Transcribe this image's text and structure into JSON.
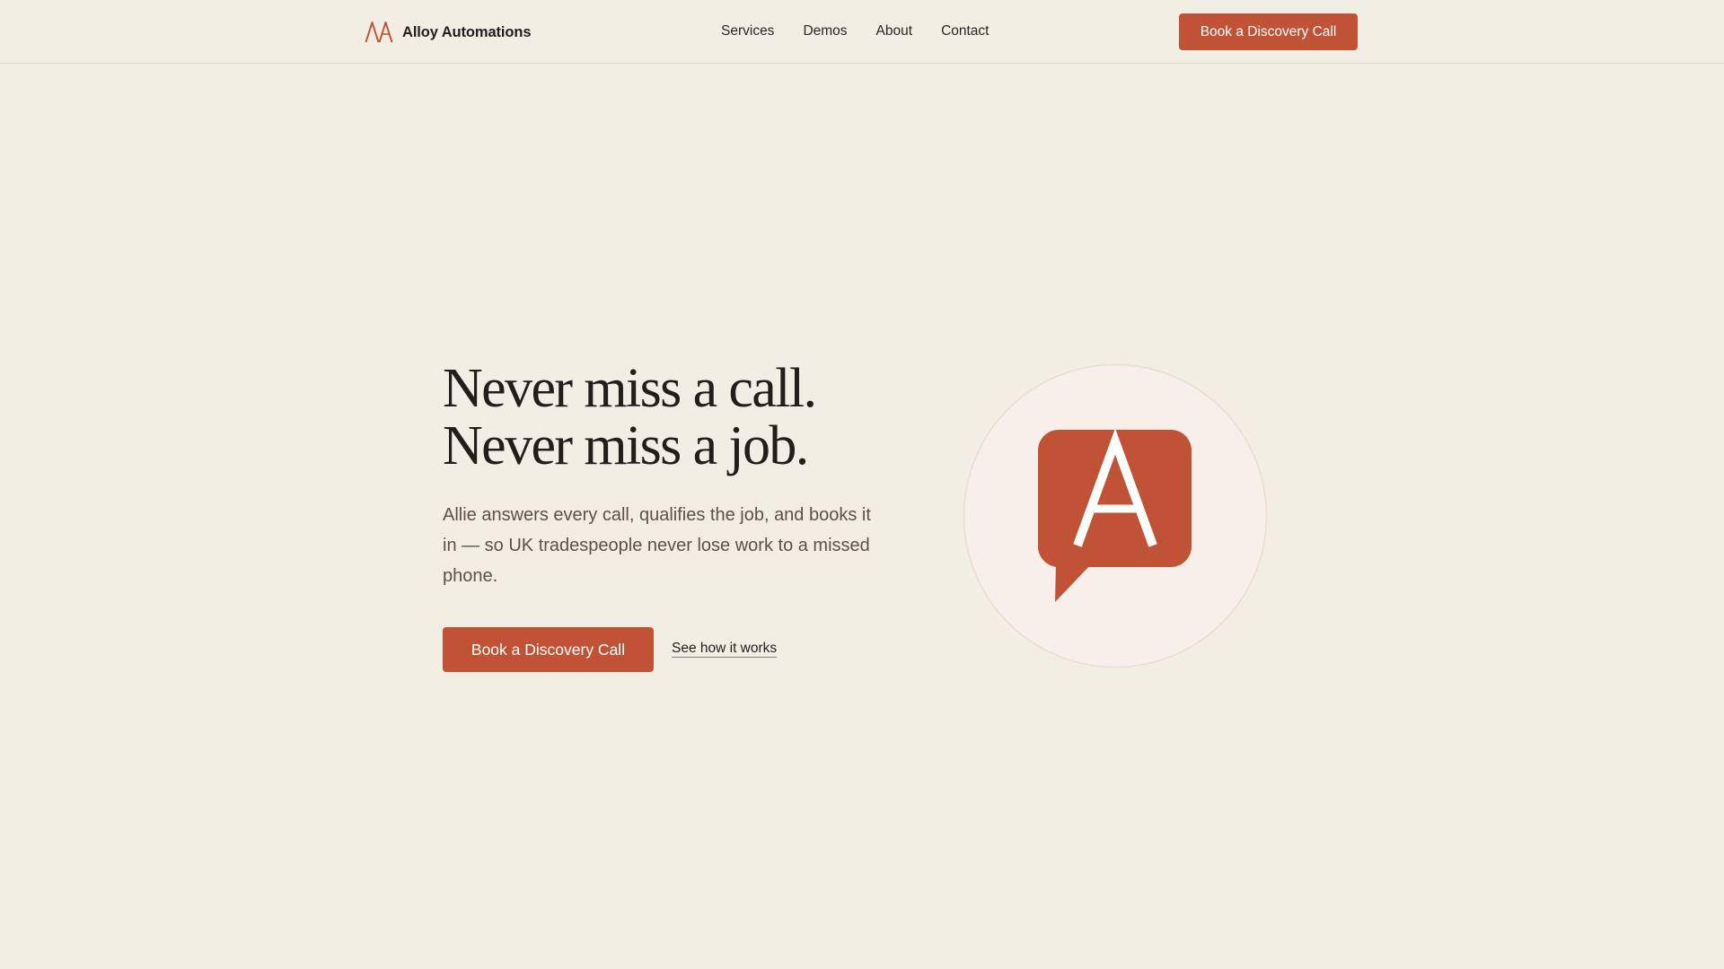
{
  "brand": {
    "name": "Alloy Automations",
    "logo_icon": "double-a-monogram-icon",
    "accent_color": "#C05236"
  },
  "nav": {
    "items": [
      {
        "label": "Services"
      },
      {
        "label": "Demos"
      },
      {
        "label": "About"
      },
      {
        "label": "Contact"
      }
    ]
  },
  "header": {
    "cta_label": "Book a Discovery Call"
  },
  "hero": {
    "headline_line1": "Never miss a call.",
    "headline_line2": "Never miss a job.",
    "body": "Allie answers every call, qualifies the job, and books it in — so UK tradespeople never lose work to a missed phone.",
    "primary_cta_label": "Book a Discovery Call",
    "secondary_cta_label": "See how it works",
    "illustration_icon": "chat-bubble-a-icon"
  },
  "colors": {
    "background": "#F3EEE4",
    "accent": "#C05236",
    "text": "#221F1B",
    "muted_text": "#5A524A",
    "illustration_circle": "#F9EFEA"
  }
}
